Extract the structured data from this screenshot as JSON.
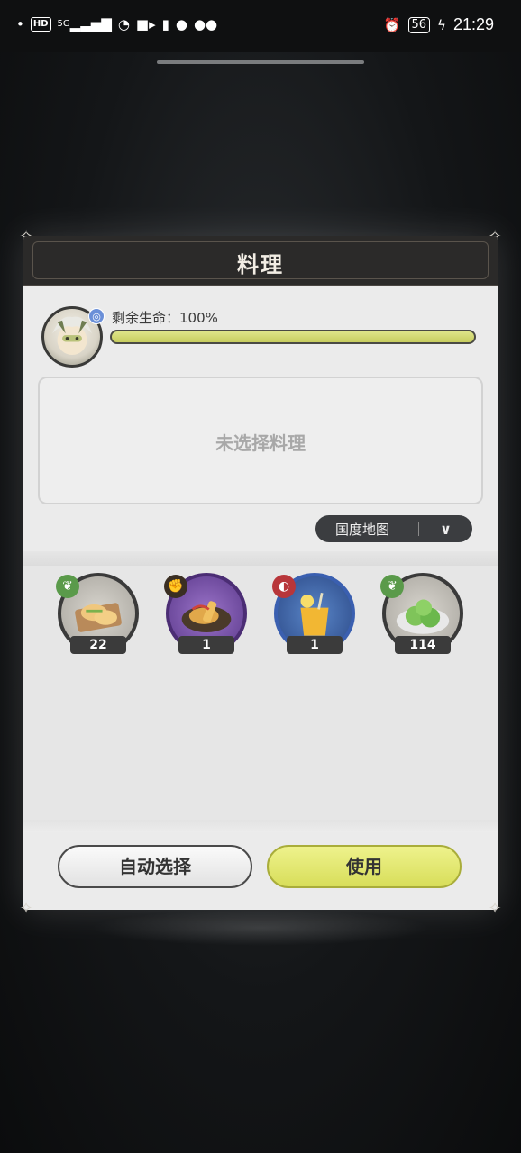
{
  "status_bar": {
    "left_icons": [
      "dot",
      "hd-icon",
      "5g-signal-icon",
      "wifi-icon",
      "video-icon",
      "cup-icon",
      "chat-icon",
      "wechat-icon"
    ],
    "hd": "HD",
    "network": "5G",
    "battery": "56",
    "time": "21:29"
  },
  "dialog": {
    "title": "料理",
    "hp_label": "剩余生命：100%",
    "hp_fraction": 1.0,
    "selection_placeholder": "未选择料理",
    "filter": {
      "label": "国度地图",
      "chevron": "⌄"
    },
    "items": [
      {
        "name": "flatbread-dish",
        "badge": "leaf",
        "count": "22",
        "rarity": "gray"
      },
      {
        "name": "fried-fish-dish",
        "badge": "fist",
        "count": "1",
        "rarity": "purple"
      },
      {
        "name": "citrus-drink",
        "badge": "shield",
        "count": "1",
        "rarity": "blue"
      },
      {
        "name": "green-dumplings",
        "badge": "leaf",
        "count": "114",
        "rarity": "gray"
      }
    ],
    "auto_select_label": "自动选择",
    "use_label": "使用"
  },
  "colors": {
    "hp_fill": "#c7cd5e",
    "use_button": "#d8de5a",
    "header_bg": "#2b2a29"
  }
}
